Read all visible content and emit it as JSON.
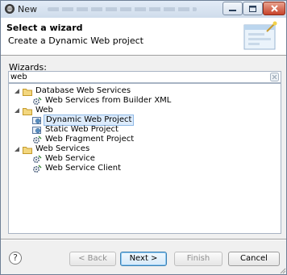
{
  "window": {
    "title": "New"
  },
  "header": {
    "title": "Select a wizard",
    "subtitle": "Create a Dynamic Web project"
  },
  "filter": {
    "label": "Wizards:",
    "value": "web"
  },
  "tree": {
    "categories": [
      {
        "label": "Database Web Services",
        "expanded": true,
        "items": [
          {
            "label": "Web Services from Builder XML",
            "icon": "gear-icon"
          }
        ]
      },
      {
        "label": "Web",
        "expanded": true,
        "items": [
          {
            "label": "Dynamic Web Project",
            "icon": "web-project-icon",
            "selected": true
          },
          {
            "label": "Static Web Project",
            "icon": "web-project-icon"
          },
          {
            "label": "Web Fragment Project",
            "icon": "gear-icon"
          }
        ]
      },
      {
        "label": "Web Services",
        "expanded": true,
        "items": [
          {
            "label": "Web Service",
            "icon": "gear-icon"
          },
          {
            "label": "Web Service Client",
            "icon": "gear-icon"
          }
        ]
      }
    ]
  },
  "buttons": {
    "back": "< Back",
    "next": "Next >",
    "finish": "Finish",
    "cancel": "Cancel"
  },
  "colors": {
    "selection": "#dcebfc",
    "selection_border": "#8fb9e6",
    "folder": "#e9c35b",
    "close_button": "#c7432b"
  }
}
